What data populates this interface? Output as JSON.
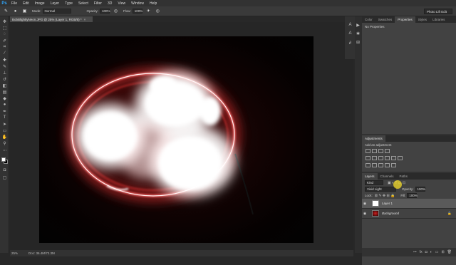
{
  "app": {
    "logo": "Ps"
  },
  "menu": [
    "File",
    "Edit",
    "Image",
    "Layer",
    "Type",
    "Select",
    "Filter",
    "3D",
    "View",
    "Window",
    "Help"
  ],
  "options": {
    "mode_label": "Mode:",
    "mode_value": "Normal",
    "opacity_label": "Opacity:",
    "opacity_value": "100%",
    "flow_label": "Flow:",
    "flow_value": "100%",
    "workspace": "Photo Lift Edit"
  },
  "document": {
    "tab_title": "BobBlightlyNeon.JPG @ 25% (Layer 1, RGB/8) *",
    "zoom": "25%",
    "doc_info": "Doc: 36.4M/72.3M"
  },
  "panels": {
    "top_tabs": [
      "Color",
      "Swatches",
      "Properties",
      "Styles",
      "Libraries"
    ],
    "top_active": "Properties",
    "properties_text": "No Properties",
    "adjustments_title": "Adjustments",
    "adjustments_hint": "Add an adjustment",
    "layers_tabs": [
      "Layers",
      "Channels",
      "Paths"
    ],
    "filter_kind": "Kind",
    "blend_mode": "Vivid Light",
    "opacity_label": "Opacity:",
    "opacity_value": "100%",
    "lock_label": "Lock:",
    "fill_label": "Fill:",
    "fill_value": "100%",
    "layers": [
      {
        "name": "Layer 1"
      },
      {
        "name": "Background"
      }
    ]
  },
  "colors": {
    "accent": "#31a8ff",
    "cursor": "#ffe628"
  }
}
